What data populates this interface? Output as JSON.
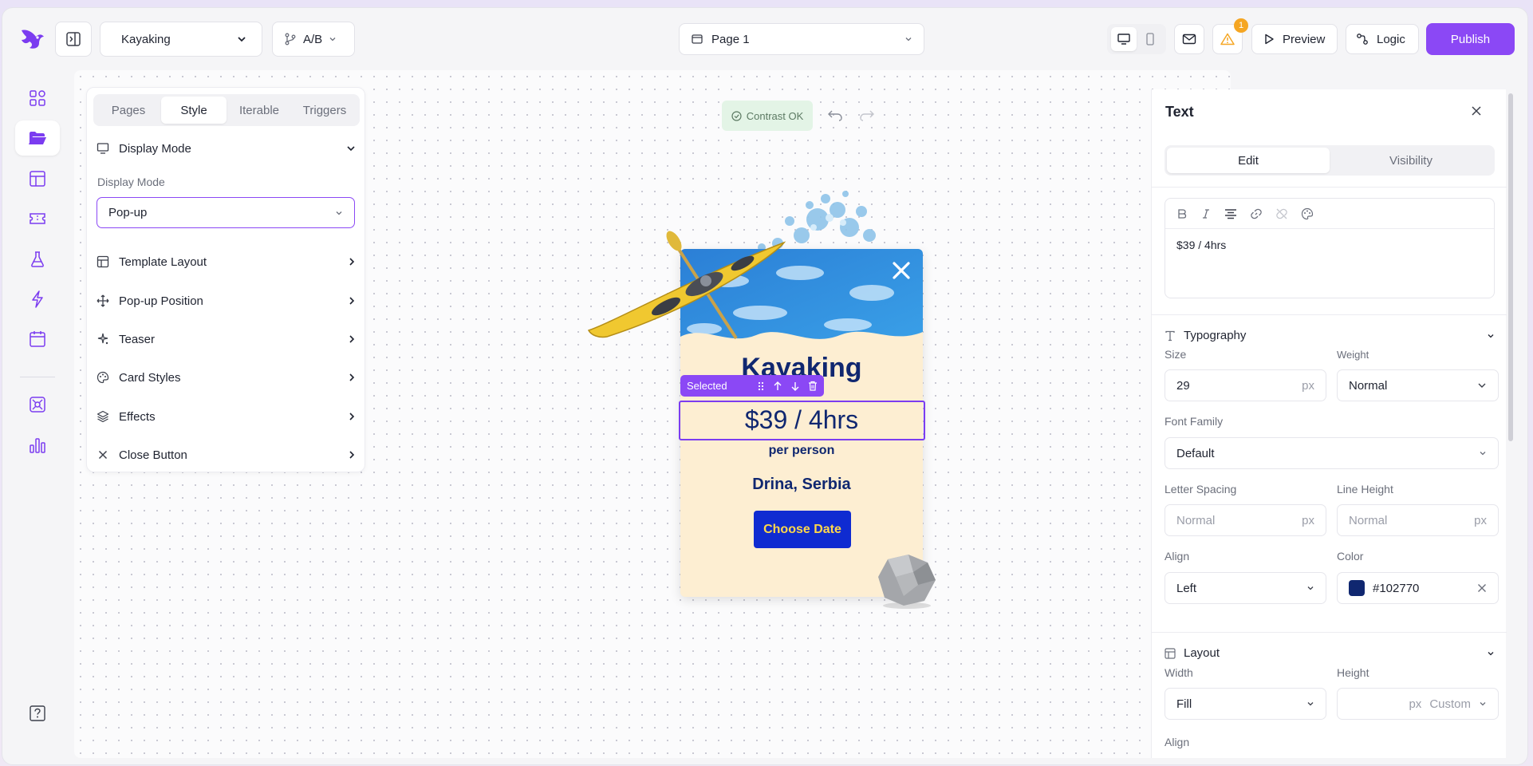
{
  "topbar": {
    "campaign": "Kayaking",
    "ab_label": "A/B",
    "page": "Page 1",
    "warning_count": "1",
    "preview_label": "Preview",
    "logic_label": "Logic",
    "publish_label": "Publish"
  },
  "rail": {
    "icons": [
      "grid-icon",
      "folder-icon",
      "layout-icon",
      "ticket-icon",
      "flask-icon",
      "bolt-icon",
      "calendar-icon",
      "integrations-icon",
      "analytics-icon",
      "help-icon"
    ],
    "active": "folder-icon"
  },
  "style_panel": {
    "tabs": [
      "Pages",
      "Style",
      "Iterable",
      "Triggers"
    ],
    "active_tab": "Style",
    "display_mode_header": "Display Mode",
    "display_mode_label": "Display Mode",
    "display_mode_value": "Pop-up",
    "sections": [
      "Template Layout",
      "Pop-up Position",
      "Teaser",
      "Card Styles",
      "Effects",
      "Close Button"
    ]
  },
  "canvas": {
    "contrast_label": "Contrast OK",
    "selection_label": "Selected"
  },
  "popup": {
    "title": "Kayaking",
    "price": "$39 / 4hrs",
    "per": "per person",
    "location": "Drina, Serbia",
    "cta": "Choose Date"
  },
  "right_panel": {
    "title": "Text",
    "tabs": [
      "Edit",
      "Visibility"
    ],
    "active_tab": "Edit",
    "editor_text": "$39 / 4hrs",
    "typography": {
      "header": "Typography",
      "size_label": "Size",
      "size_value": "29",
      "size_unit": "px",
      "weight_label": "Weight",
      "weight_value": "Normal",
      "font_family_label": "Font Family",
      "font_family_value": "Default",
      "letter_spacing_label": "Letter Spacing",
      "letter_spacing_value": "Normal",
      "letter_spacing_unit": "px",
      "line_height_label": "Line Height",
      "line_height_value": "Normal",
      "line_height_unit": "px",
      "align_label": "Align",
      "align_value": "Left",
      "color_label": "Color",
      "color_value": "#102770"
    },
    "layout": {
      "header": "Layout",
      "width_label": "Width",
      "width_value": "Fill",
      "height_label": "Height",
      "height_unit": "px",
      "height_mode": "Custom",
      "align_label": "Align"
    }
  },
  "colors": {
    "accent": "#8b48f5",
    "text_navy": "#102770",
    "cta_blue": "#0f2bd1",
    "cta_text": "#ffd84a",
    "card_bg": "#fdeed2"
  }
}
